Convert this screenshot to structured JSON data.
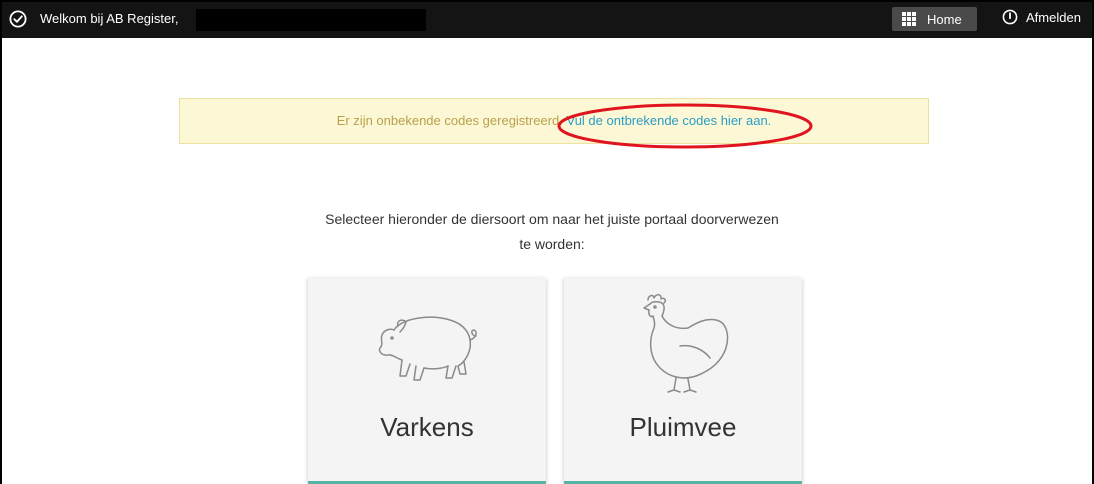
{
  "topbar": {
    "welcome_text": "Welkom bij AB Register,",
    "home_label": "Home",
    "logout_label": "Afmelden"
  },
  "alert": {
    "message": "Er zijn onbekende codes geregistreerd.",
    "link_text": "Vul de ontbrekende codes hier aan."
  },
  "instruction": {
    "line1": "Selecteer hieronder de diersoort om naar het juiste portaal doorverwezen",
    "line2": "te worden:"
  },
  "cards": [
    {
      "label": "Varkens",
      "icon": "pig-icon"
    },
    {
      "label": "Pluimvee",
      "icon": "chicken-icon"
    }
  ],
  "colors": {
    "topbar_bg": "#141414",
    "alert_bg": "#fcf8d6",
    "alert_text": "#b9a04a",
    "link": "#2c9cc6",
    "card_accent": "#56b3a4",
    "annotation": "#e0141e"
  }
}
